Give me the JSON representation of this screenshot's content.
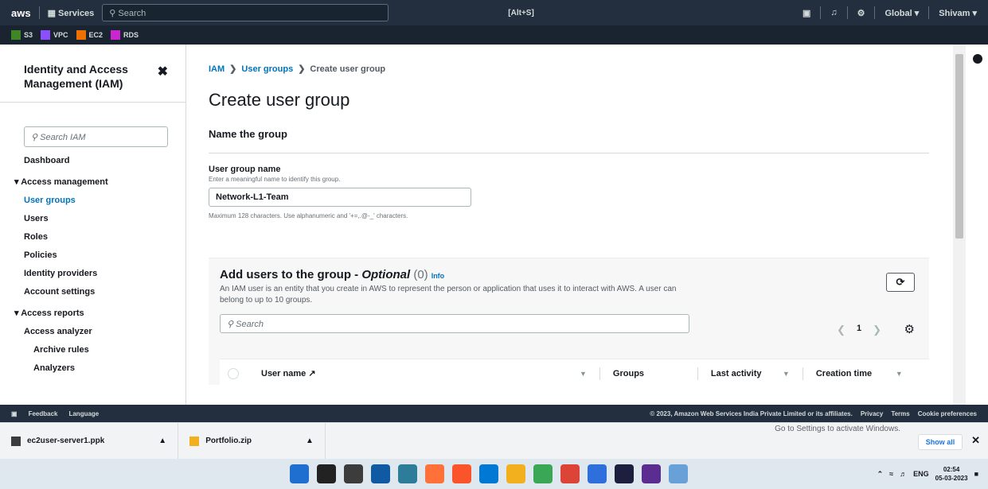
{
  "topnav": {
    "logo": "aws",
    "services": "Services",
    "search_placeholder": "Search",
    "shortcut": "[Alt+S]",
    "region": "Global",
    "account": "Shivam",
    "favorites": [
      {
        "label": "S3",
        "color": "#3f8624"
      },
      {
        "label": "VPC",
        "color": "#8c4fff"
      },
      {
        "label": "EC2",
        "color": "#ed7100"
      },
      {
        "label": "RDS",
        "color": "#c925d1"
      }
    ]
  },
  "sidebar": {
    "title": "Identity and Access Management (IAM)",
    "search_placeholder": "Search IAM",
    "dashboard": "Dashboard",
    "access_management": "Access management",
    "items": [
      "User groups",
      "Users",
      "Roles",
      "Policies",
      "Identity providers",
      "Account settings"
    ],
    "access_reports": "Access reports",
    "reports": [
      "Access analyzer"
    ],
    "analyzer_sub": [
      "Archive rules",
      "Analyzers"
    ]
  },
  "breadcrumb": {
    "iam": "IAM",
    "user_groups": "User groups",
    "current": "Create user group"
  },
  "page_title": "Create user group",
  "name_section": {
    "heading": "Name the group",
    "label": "User group name",
    "description": "Enter a meaningful name to identify this group.",
    "value": "Network-L1-Team",
    "hint": "Maximum 128 characters. Use alphanumeric and '+=,.@-_' characters."
  },
  "users_panel": {
    "title": "Add users to the group - ",
    "optional": "Optional",
    "count": "(0)",
    "info": "Info",
    "description": "An IAM user is an entity that you create in AWS to represent the person or application that uses it to interact with AWS. A user can belong to up to 10 groups.",
    "search_placeholder": "Search",
    "page": "1",
    "columns": [
      "User name",
      "Groups",
      "Last activity",
      "Creation time"
    ]
  },
  "footer": {
    "links": [
      "Feedback",
      "Language"
    ],
    "copyright": "© 2023, Amazon Web Services India Private Limited or its affiliates.",
    "right": [
      "Privacy",
      "Terms",
      "Cookie preferences"
    ]
  },
  "downloads": {
    "files": [
      "ec2user-server1.ppk",
      "Portfolio.zip"
    ],
    "activate_windows": "Go to Settings to activate Windows.",
    "show_all": "Show all"
  },
  "taskbar": {
    "lang": "ENG",
    "time": "02:54",
    "date": "05-03-2023",
    "apps": [
      "#1f6fd1",
      "#222222",
      "#3c3c3c",
      "#0f5aa3",
      "#2d7d9a",
      "#ff7139",
      "#fb542b",
      "#0078d4",
      "#f2b01e",
      "#3aa757",
      "#db4437",
      "#2f6fdb",
      "#1e1e3f",
      "#5c2d91",
      "#68a0d8"
    ]
  }
}
